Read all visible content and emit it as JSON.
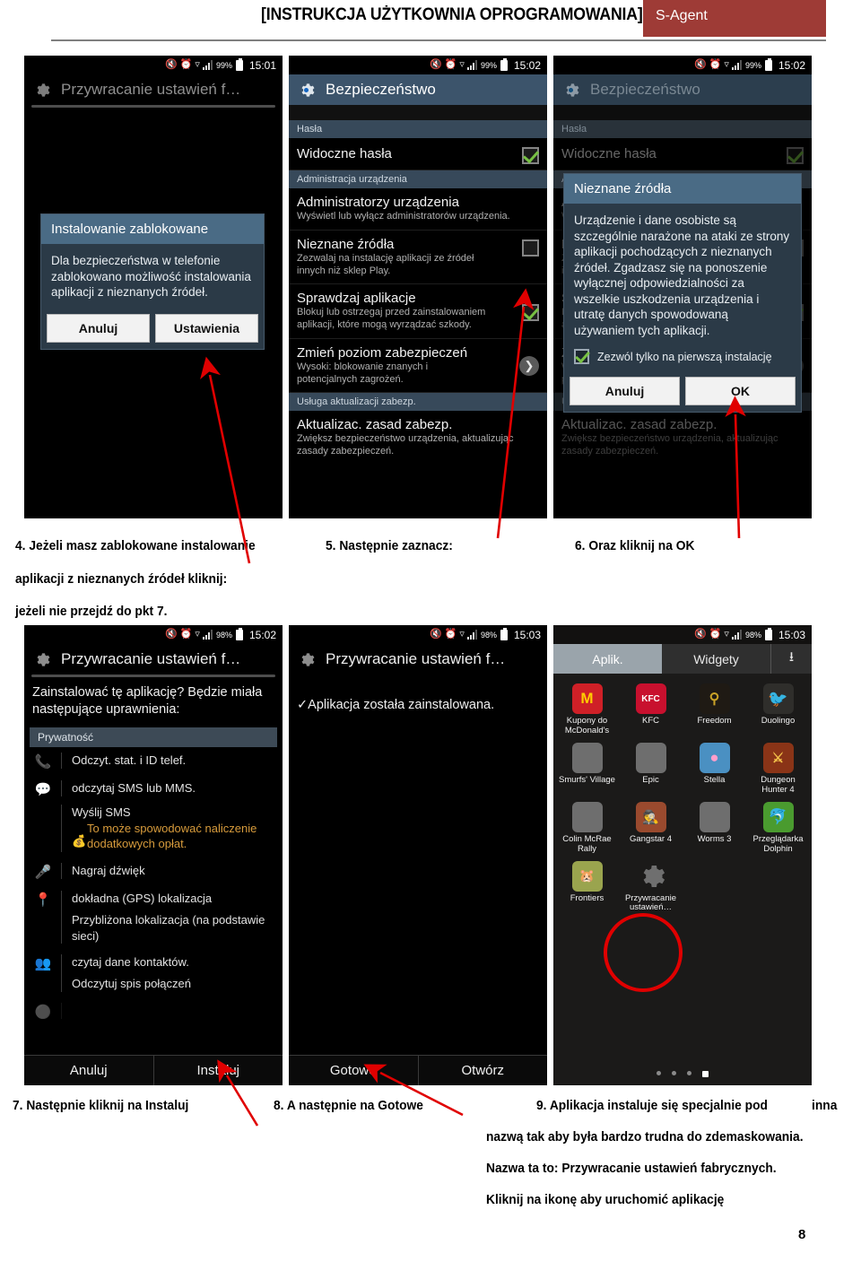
{
  "header": {
    "title_bracketed": "[INSTRUKCJA UŻYTKOWNIA OPROGRAMOWANIA]",
    "badge": "S-Agent"
  },
  "page_number": "8",
  "captions": {
    "c4_line1": "4. Jeżeli masz zablokowane instalowanie",
    "c4_line2": "aplikacji z nieznanych źródeł kliknij:",
    "c4_line3": "jeżeli nie przejdź do pkt 7.",
    "c5": "5. Następnie zaznacz:",
    "c6": "6. Oraz kliknij na OK",
    "c7": "7. Następnie kliknij na Instaluj",
    "c8": "8. A następnie na Gotowe",
    "c9_line1": "9. Aplikacja instaluje się specjalnie pod",
    "c9_line1b": "inna",
    "c9_line2": "nazwą tak aby była bardzo trudna do zdemaskowania.",
    "c9_line3": "Nazwa ta to: Przywracanie ustawień fabrycznych.",
    "c9_line4": "Kliknij na ikonę aby uruchomić aplikację"
  },
  "screens": {
    "s1": {
      "status": {
        "battery": "99%",
        "time": "15:01"
      },
      "app_title": "Przywracanie ustawień f…",
      "dialog": {
        "title": "Instalowanie zablokowane",
        "body": "Dla bezpieczeństwa w telefonie zablokowano możliwość instalowania aplikacji z nieznanych źródeł.",
        "cancel": "Anuluj",
        "ok": "Ustawienia"
      }
    },
    "s2": {
      "status": {
        "battery": "99%",
        "time": "15:02"
      },
      "app_title": "Bezpieczeństwo",
      "sections": {
        "passwords": "Hasła",
        "device_admin": "Administracja urządzenia",
        "update_service": "Usługa aktualizacji zabezp."
      },
      "rows": [
        {
          "title": "Widoczne hasła",
          "sub": "",
          "checked": true
        },
        {
          "title": "Administratorzy urządzenia",
          "sub": "Wyświetl lub wyłącz administratorów urządzenia.",
          "checked": null
        },
        {
          "title": "Nieznane źródła",
          "sub": "Zezwalaj na instalację aplikacji ze źródeł innych niż sklep Play.",
          "checked": false
        },
        {
          "title": "Sprawdzaj aplikacje",
          "sub": "Blokuj lub ostrzegaj przed zainstalowaniem aplikacji, które mogą wyrządzać szkody.",
          "checked": true
        },
        {
          "title": "Zmień poziom zabezpieczeń",
          "sub": "Wysoki: blokowanie znanych i potencjalnych zagrożeń.",
          "checked": null
        },
        {
          "title": "Aktualizac. zasad zabezp.",
          "sub": "Zwiększ bezpieczeństwo urządzenia, aktualizując zasady zabezpieczeń.",
          "checked": null
        }
      ]
    },
    "s3": {
      "status": {
        "battery": "99%",
        "time": "15:02"
      },
      "app_title": "Bezpieczeństwo",
      "dialog": {
        "title": "Nieznane źródła",
        "body": "Urządzenie i dane osobiste są szczególnie narażone na ataki ze strony aplikacji pochodzących z nieznanych źródeł. Zgadzasz się na ponoszenie wyłącznej odpowiedzialności za wszelkie uszkodzenia urządzenia i utratę danych spowodowaną używaniem tych aplikacji.",
        "checkbox_label": "Zezwól tylko na pierwszą instalację",
        "checkbox_checked": true,
        "cancel": "Anuluj",
        "ok": "OK"
      }
    },
    "s4": {
      "status": {
        "battery": "98%",
        "time": "15:02"
      },
      "app_title": "Przywracanie ustawień f…",
      "prompt": "Zainstalować tę aplikację? Będzie miała następujące uprawnienia:",
      "section": "Prywatność",
      "permissions": [
        {
          "icon": "phone-icon",
          "lines": [
            "Odczyt. stat. i ID telef."
          ]
        },
        {
          "icon": "message-icon",
          "lines": [
            "odczytaj SMS lub MMS."
          ]
        },
        {
          "icon": "none",
          "lines": [
            "Wyślij SMS"
          ],
          "warn": "To może spowodować naliczenie dodatkowych opłat."
        },
        {
          "icon": "microphone-icon",
          "lines": [
            "Nagraj dźwięk"
          ]
        },
        {
          "icon": "location-pin-icon",
          "lines": [
            "dokładna (GPS) lokalizacja",
            "Przybliżona lokalizacja (na podstawie sieci)"
          ]
        },
        {
          "icon": "contacts-icon",
          "lines": [
            "czytaj dane kontaktów.",
            "Odczytuj spis połączeń"
          ]
        }
      ],
      "buttons": {
        "cancel": "Anuluj",
        "install": "Instaluj"
      }
    },
    "s5": {
      "status": {
        "battery": "98%",
        "time": "15:03"
      },
      "app_title": "Przywracanie ustawień f…",
      "message": "Aplikacja została zainstalowana.",
      "buttons": {
        "done": "Gotowe",
        "open": "Otwórz"
      }
    },
    "s6": {
      "status": {
        "battery": "98%",
        "time": "15:03"
      },
      "tabs": {
        "apps": "Aplik.",
        "widgets": "Widgety",
        "download_icon": "download-icon"
      },
      "apps": [
        {
          "label": "Kupony do McDonald's",
          "glyph": "M",
          "bg": "#cf2027"
        },
        {
          "label": "KFC",
          "glyph": "KFC",
          "bg": "#c8102e"
        },
        {
          "label": "Freedom",
          "glyph": "",
          "bg": "#2a2218"
        },
        {
          "label": "Duolingo",
          "glyph": "",
          "bg": "#3f3f3f"
        },
        {
          "label": "Smurfs' Village",
          "glyph": "",
          "bg": "#6b6b6b"
        },
        {
          "label": "Epic",
          "glyph": "",
          "bg": "#6b6b6b"
        },
        {
          "label": "Stella",
          "glyph": "",
          "bg": "#3d7fb5"
        },
        {
          "label": "Dungeon Hunter 4",
          "glyph": "",
          "bg": "#8a3417"
        },
        {
          "label": "Colin McRae Rally",
          "glyph": "",
          "bg": "#6b6b6b"
        },
        {
          "label": "Gangstar 4",
          "glyph": "",
          "bg": "#9a4a2e"
        },
        {
          "label": "Worms 3",
          "glyph": "",
          "bg": "#6b6b6b"
        },
        {
          "label": "Przeglądarka Dolphin",
          "glyph": "",
          "bg": "#4a9b2f"
        },
        {
          "label": "Frontiers",
          "glyph": "",
          "bg": "#8d9a4a"
        },
        {
          "label": "Przywracanie ustawień…",
          "glyph": "",
          "bg": "transparent"
        }
      ],
      "page_dots": 4,
      "active_dot": 4
    }
  },
  "colors": {
    "brand_red": "#9e3b36",
    "annotation_red": "#e00000",
    "android_blue": "#3c546b",
    "checkbox_green": "#77c043"
  }
}
